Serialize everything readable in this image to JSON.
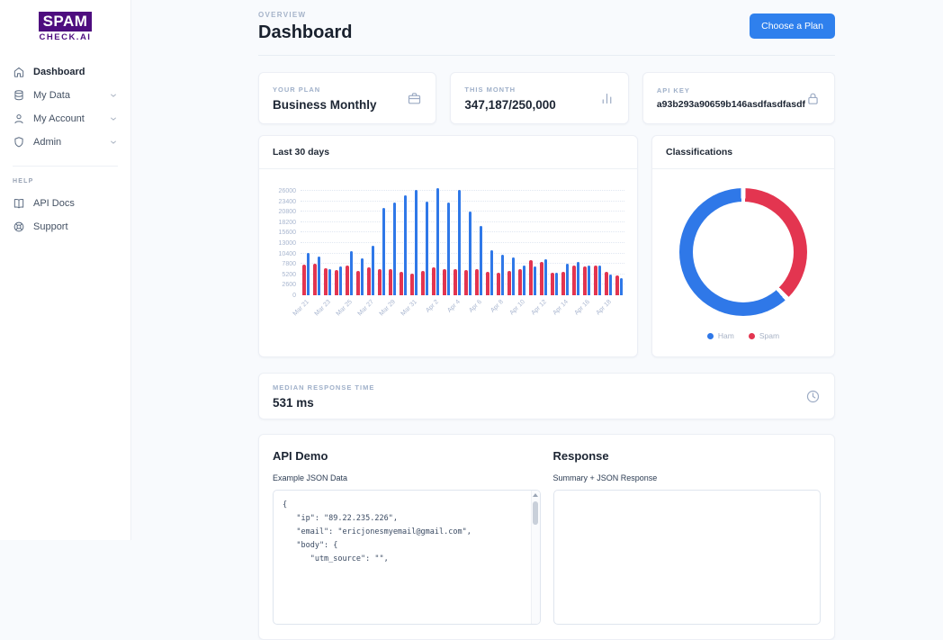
{
  "app": {
    "logo_top": "SPAM",
    "logo_bottom": "CHECK.AI"
  },
  "colors": {
    "logo_purple": "#4e0d7f",
    "accent_blue": "#2f80ed",
    "bar_blue": "#2f78e8",
    "bar_red": "#e33550"
  },
  "sidebar": {
    "items": [
      {
        "label": "Dashboard",
        "icon": "home-icon",
        "active": true,
        "chevron": false
      },
      {
        "label": "My Data",
        "icon": "database-icon",
        "active": false,
        "chevron": true
      },
      {
        "label": "My Account",
        "icon": "user-icon",
        "active": false,
        "chevron": true
      },
      {
        "label": "Admin",
        "icon": "shield-icon",
        "active": false,
        "chevron": true
      }
    ],
    "help_label": "HELP",
    "help_items": [
      {
        "label": "API Docs",
        "icon": "book-icon",
        "active": false,
        "chevron": false
      },
      {
        "label": "Support",
        "icon": "support-icon",
        "active": false,
        "chevron": false
      }
    ]
  },
  "header": {
    "eyebrow": "OVERVIEW",
    "title": "Dashboard",
    "cta_label": "Choose a Plan"
  },
  "stats": {
    "cards": [
      {
        "label": "YOUR PLAN",
        "value": "Business Monthly",
        "icon": "briefcase-icon",
        "small": false
      },
      {
        "label": "THIS MONTH",
        "value": "347,187/250,000",
        "icon": "bar-chart-icon",
        "small": false
      },
      {
        "label": "API KEY",
        "value": "a93b293a90659b146asdfasdfasdf",
        "icon": "lock-icon",
        "small": true
      }
    ]
  },
  "median": {
    "label": "MEDIAN RESPONSE TIME",
    "value": "531 ms",
    "icon": "clock-icon"
  },
  "api_demo": {
    "title": "API Demo",
    "input_label": "Example JSON Data",
    "code_lines": [
      "{",
      "   \"ip\": \"89.22.235.226\",",
      "   \"email\": \"ericjonesmyemail@gmail.com\",",
      "   \"body\": {",
      "      \"utm_source\": \"\","
    ],
    "response_title": "Response",
    "response_label": "Summary + JSON Response"
  },
  "chart_data": [
    {
      "type": "bar",
      "title": "Last 30 days",
      "categories": [
        "Mar 21",
        "Mar 22",
        "Mar 23",
        "Mar 24",
        "Mar 25",
        "Mar 26",
        "Mar 27",
        "Mar 28",
        "Mar 29",
        "Mar 30",
        "Mar 31",
        "Apr 1",
        "Apr 2",
        "Apr 3",
        "Apr 4",
        "Apr 5",
        "Apr 6",
        "Apr 7",
        "Apr 8",
        "Apr 9",
        "Apr 10",
        "Apr 11",
        "Apr 12",
        "Apr 13",
        "Apr 14",
        "Apr 15",
        "Apr 16",
        "Apr 17",
        "Apr 18",
        "Apr 19"
      ],
      "tick_every": 2,
      "series": [
        {
          "name": "Spam",
          "color": "#e33550",
          "values": [
            7700,
            7900,
            6700,
            6300,
            7300,
            6100,
            7000,
            6500,
            6400,
            5800,
            5400,
            6000,
            6900,
            6400,
            6600,
            6200,
            6400,
            5900,
            5500,
            6100,
            6400,
            8700,
            8300,
            5700,
            5800,
            7400,
            7200,
            7400,
            5800,
            5000
          ]
        },
        {
          "name": "Ham",
          "color": "#2f78e8",
          "values": [
            10500,
            9700,
            6500,
            7100,
            11000,
            9300,
            12300,
            21700,
            23200,
            24900,
            26300,
            23300,
            26700,
            23000,
            26200,
            20800,
            17300,
            11300,
            10200,
            9500,
            7500,
            7200,
            9000,
            5500,
            7900,
            8400,
            7500,
            7500,
            5100,
            4300
          ]
        }
      ],
      "ylim": [
        0,
        26000
      ],
      "yticks": [
        0,
        2600,
        5200,
        7800,
        10400,
        13000,
        15600,
        18200,
        20800,
        23400,
        26000
      ],
      "grid": "dotted-horizontal",
      "legend_position": "none"
    },
    {
      "type": "donut",
      "title": "Classifications",
      "slices": [
        {
          "label": "Ham",
          "value": 62,
          "color": "#2f78e8"
        },
        {
          "label": "Spam",
          "value": 38,
          "color": "#e33550"
        }
      ],
      "start": "top-clockwise-spam-first",
      "legend_position": "bottom"
    }
  ]
}
